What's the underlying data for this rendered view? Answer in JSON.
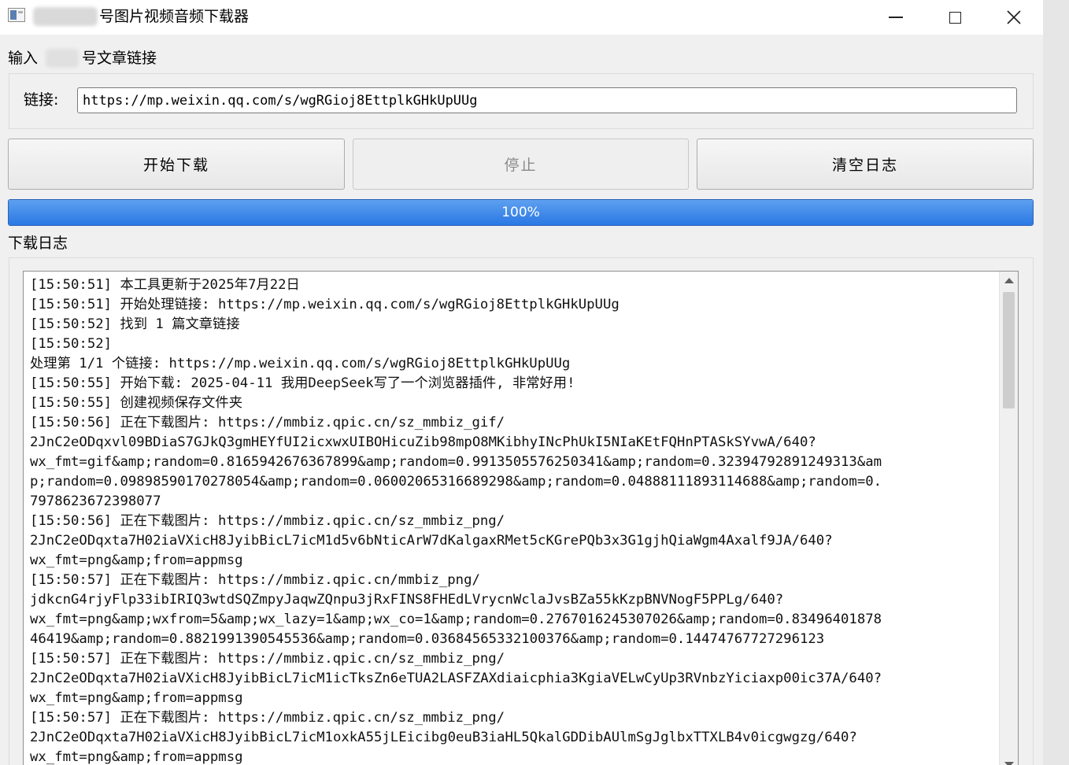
{
  "window": {
    "title": "号图片视频音频下载器",
    "controls": [
      "minimize-icon",
      "maximize-icon",
      "close-icon"
    ]
  },
  "input_section": {
    "label_prefix": "输入",
    "label_suffix": "号文章链接",
    "url_label": "链接:",
    "url_value": "https://mp.weixin.qq.com/s/wgRGioj8EttplkGHkUpUUg"
  },
  "buttons": {
    "start": "开始下载",
    "stop": "停止",
    "clear": "清空日志"
  },
  "progress": {
    "value": 100,
    "text": "100%",
    "color": "#2a78e4"
  },
  "log": {
    "label": "下载日志",
    "lines": [
      "[15:50:51] 本工具更新于2025年7月22日",
      "[15:50:51] 开始处理链接: https://mp.weixin.qq.com/s/wgRGioj8EttplkGHkUpUUg",
      "[15:50:52] 找到 1 篇文章链接",
      "[15:50:52]",
      "处理第 1/1 个链接: https://mp.weixin.qq.com/s/wgRGioj8EttplkGHkUpUUg",
      "[15:50:55] 开始下载: 2025-04-11 我用DeepSeek写了一个浏览器插件, 非常好用!",
      "[15:50:55] 创建视频保存文件夹",
      "[15:50:56] 正在下载图片: https://mmbiz.qpic.cn/sz_mmbiz_gif/",
      "2JnC2eODqxvl09BDiaS7GJkQ3gmHEYfUI2icxwxUIBOHicuZib98mpO8MKibhyINcPhUkI5NIaKEtFQHnPTASkSYvwA/640?",
      "wx_fmt=gif&amp;random=0.8165942676367899&amp;random=0.9913505576250341&amp;random=0.32394792891249313&am",
      "p;random=0.09898590170278054&amp;random=0.06002065316689298&amp;random=0.04888111893114688&amp;random=0.",
      "7978623672398077",
      "[15:50:56] 正在下载图片: https://mmbiz.qpic.cn/sz_mmbiz_png/",
      "2JnC2eODqxta7H02iaVXicH8JyibBicL7icM1d5v6bNticArW7dKalgaxRMet5cKGrePQb3x3G1gjhQiaWgm4Axalf9JA/640?",
      "wx_fmt=png&amp;from=appmsg",
      "[15:50:57] 正在下载图片: https://mmbiz.qpic.cn/mmbiz_png/",
      "jdkcnG4rjyFlp33ibIRIQ3wtdSQZmpyJaqwZQnpu3jRxFINS8FHEdLVrycnWclaJvsBZa55kKzpBNVNogF5PPLg/640?",
      "wx_fmt=png&amp;wxfrom=5&amp;wx_lazy=1&amp;wx_co=1&amp;random=0.2767016245307026&amp;random=0.83496401878",
      "46419&amp;random=0.8821991390545536&amp;random=0.03684565332100376&amp;random=0.14474767727296123",
      "[15:50:57] 正在下载图片: https://mmbiz.qpic.cn/sz_mmbiz_png/",
      "2JnC2eODqxta7H02iaVXicH8JyibBicL7icM1icTksZn6eTUA2LASFZAXdiaicphia3KgiaVELwCyUp3RVnbzYiciaxp00ic37A/640?",
      "wx_fmt=png&amp;from=appmsg",
      "[15:50:57] 正在下载图片: https://mmbiz.qpic.cn/sz_mmbiz_png/",
      "2JnC2eODqxta7H02iaVXicH8JyibBicL7icM1oxkA55jLEicibg0euB3iaHL5QkalGDDibAUlmSgJglbxTTXLB4v0icgwgzg/640?",
      "wx_fmt=png&amp;from=appmsg"
    ]
  }
}
